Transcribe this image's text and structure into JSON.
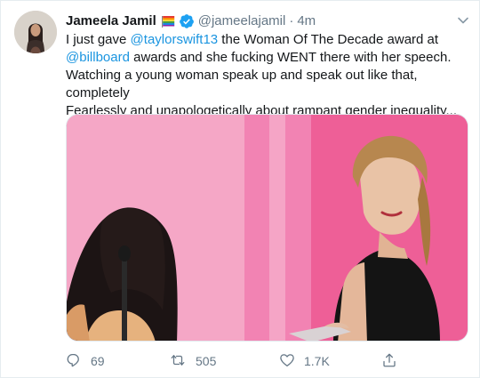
{
  "user": {
    "name": "Jameela Jamil",
    "handle": "@jameelajamil",
    "separator": "·",
    "time": "4m"
  },
  "tweet": {
    "text_1": "I just gave ",
    "mention_1": "@taylorswift13",
    "text_2": " the Woman Of The Decade award at\n",
    "mention_2": "@billboard",
    "text_3": " awards and she fucking WENT there with her speech.\nWatching a young woman speak up and speak out like that, completely\nFearlessly and unapologetically about rampant gender inequality... was\npretty iconic."
  },
  "actions": {
    "replies": "69",
    "retweets": "505",
    "likes": "1.7K"
  },
  "icons": {
    "name_emoji": "rainbow-flag-emoji",
    "verified": "verified-badge-icon",
    "menu": "chevron-down-icon",
    "heart_emoji": "red-heart-emoji",
    "reply": "reply-icon",
    "retweet": "retweet-icon",
    "like": "like-heart-icon",
    "share": "share-icon"
  },
  "colors": {
    "link": "#1b95e0",
    "verified": "#1da1f2",
    "muted": "#657786",
    "media_background": "#f26aa0"
  }
}
